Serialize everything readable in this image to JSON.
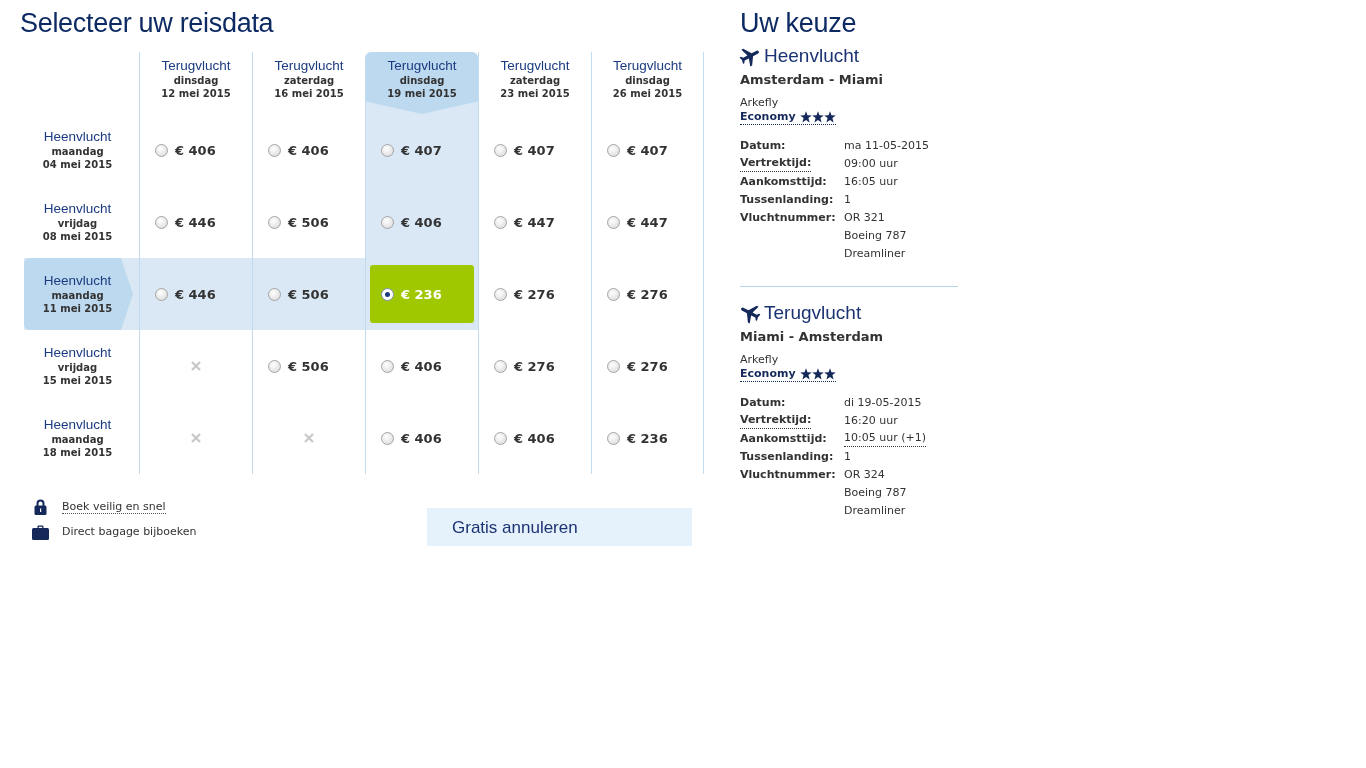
{
  "title": "Selecteer uw reisdata",
  "grid": {
    "columns": [
      {
        "label": "Terugvlucht",
        "weekday": "dinsdag",
        "date": "12 mei 2015",
        "selected": false
      },
      {
        "label": "Terugvlucht",
        "weekday": "zaterdag",
        "date": "16 mei 2015",
        "selected": false
      },
      {
        "label": "Terugvlucht",
        "weekday": "dinsdag",
        "date": "19 mei 2015",
        "selected": true
      },
      {
        "label": "Terugvlucht",
        "weekday": "zaterdag",
        "date": "23 mei 2015",
        "selected": false
      },
      {
        "label": "Terugvlucht",
        "weekday": "dinsdag",
        "date": "26 mei 2015",
        "selected": false
      }
    ],
    "rows": [
      {
        "label": "Heenvlucht",
        "weekday": "maandag",
        "date": "04 mei 2015",
        "selected": false,
        "cells": [
          {
            "kind": "fare",
            "price": "€ 406",
            "selected": false
          },
          {
            "kind": "fare",
            "price": "€ 406",
            "selected": false
          },
          {
            "kind": "fare",
            "price": "€ 407",
            "selected": false
          },
          {
            "kind": "fare",
            "price": "€ 407",
            "selected": false
          },
          {
            "kind": "fare",
            "price": "€ 407",
            "selected": false
          }
        ]
      },
      {
        "label": "Heenvlucht",
        "weekday": "vrijdag",
        "date": "08 mei 2015",
        "selected": false,
        "cells": [
          {
            "kind": "fare",
            "price": "€ 446",
            "selected": false
          },
          {
            "kind": "fare",
            "price": "€ 506",
            "selected": false
          },
          {
            "kind": "fare",
            "price": "€ 406",
            "selected": false
          },
          {
            "kind": "fare",
            "price": "€ 447",
            "selected": false
          },
          {
            "kind": "fare",
            "price": "€ 447",
            "selected": false
          }
        ]
      },
      {
        "label": "Heenvlucht",
        "weekday": "maandag",
        "date": "11 mei 2015",
        "selected": true,
        "cells": [
          {
            "kind": "fare",
            "price": "€ 446",
            "selected": false
          },
          {
            "kind": "fare",
            "price": "€ 506",
            "selected": false
          },
          {
            "kind": "fare",
            "price": "€ 236",
            "selected": true
          },
          {
            "kind": "fare",
            "price": "€ 276",
            "selected": false
          },
          {
            "kind": "fare",
            "price": "€ 276",
            "selected": false
          }
        ]
      },
      {
        "label": "Heenvlucht",
        "weekday": "vrijdag",
        "date": "15 mei 2015",
        "selected": false,
        "cells": [
          {
            "kind": "unavailable"
          },
          {
            "kind": "fare",
            "price": "€ 506",
            "selected": false
          },
          {
            "kind": "fare",
            "price": "€ 406",
            "selected": false
          },
          {
            "kind": "fare",
            "price": "€ 276",
            "selected": false
          },
          {
            "kind": "fare",
            "price": "€ 276",
            "selected": false
          }
        ]
      },
      {
        "label": "Heenvlucht",
        "weekday": "maandag",
        "date": "18 mei 2015",
        "selected": false,
        "cells": [
          {
            "kind": "unavailable"
          },
          {
            "kind": "unavailable"
          },
          {
            "kind": "fare",
            "price": "€ 406",
            "selected": false
          },
          {
            "kind": "fare",
            "price": "€ 406",
            "selected": false
          },
          {
            "kind": "fare",
            "price": "€ 236",
            "selected": false
          }
        ]
      }
    ]
  },
  "features": [
    {
      "kind": "lock",
      "text": "Boek veilig en snel",
      "link": true
    },
    {
      "kind": "suitcase",
      "text": "Direct bagage bijboeken",
      "link": false
    }
  ],
  "promo": {
    "title": "Gratis annuleren"
  },
  "summary": {
    "title": "Uw keuze",
    "flights": [
      {
        "kind": "outbound",
        "title": "Heenvlucht",
        "route": "Amsterdam - Miami",
        "airline": "Arkefly",
        "cabin": "Economy",
        "stars": 3,
        "details": [
          {
            "label": "Datum:",
            "values": [
              "ma 11-05-2015"
            ],
            "label_tooltip": false,
            "value_tooltip": false
          },
          {
            "label": "Vertrektijd:",
            "values": [
              "09:00 uur"
            ],
            "label_tooltip": true,
            "value_tooltip": false
          },
          {
            "label": "Aankomsttijd:",
            "values": [
              "16:05 uur"
            ],
            "label_tooltip": false,
            "value_tooltip": false
          },
          {
            "label": "Tussenlanding:",
            "values": [
              "1"
            ],
            "label_tooltip": false,
            "value_tooltip": false
          },
          {
            "label": "Vluchtnummer:",
            "values": [
              "OR 321",
              "Boeing 787 Dreamliner"
            ],
            "label_tooltip": false,
            "value_tooltip": false
          }
        ]
      },
      {
        "kind": "return",
        "title": "Terugvlucht",
        "route": "Miami - Amsterdam",
        "airline": "Arkefly",
        "cabin": "Economy",
        "stars": 3,
        "details": [
          {
            "label": "Datum:",
            "values": [
              "di 19-05-2015"
            ],
            "label_tooltip": false,
            "value_tooltip": false
          },
          {
            "label": "Vertrektijd:",
            "values": [
              "16:20 uur"
            ],
            "label_tooltip": true,
            "value_tooltip": false
          },
          {
            "label": "Aankomsttijd:",
            "values": [
              "10:05 uur (+1)"
            ],
            "label_tooltip": false,
            "value_tooltip": true
          },
          {
            "label": "Tussenlanding:",
            "values": [
              "1"
            ],
            "label_tooltip": false,
            "value_tooltip": false
          },
          {
            "label": "Vluchtnummer:",
            "values": [
              "OR 324",
              "Boeing 787 Dreamliner"
            ],
            "label_tooltip": false,
            "value_tooltip": false
          }
        ]
      }
    ]
  }
}
